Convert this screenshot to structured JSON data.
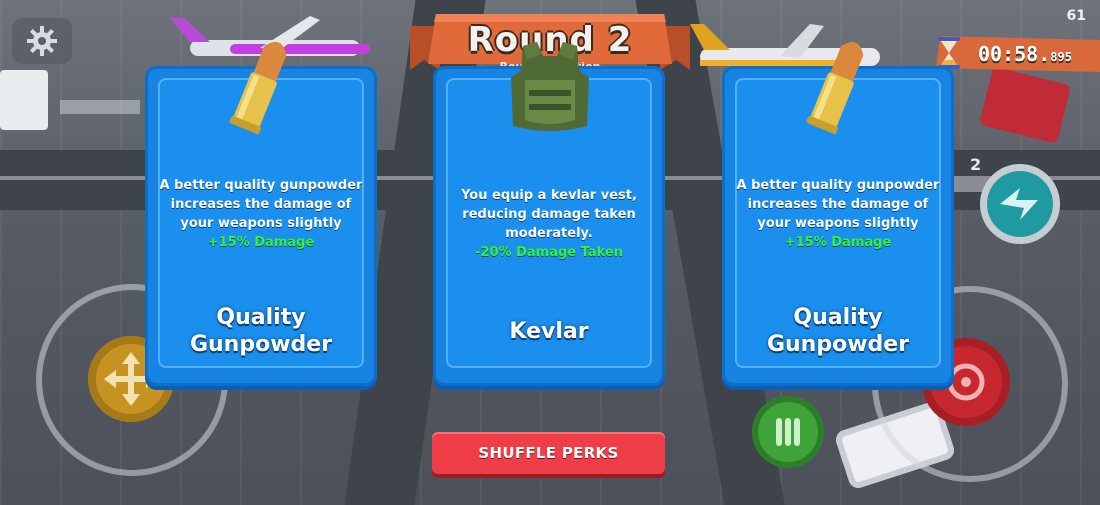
{
  "header": {
    "round_title": "Round 2",
    "round_subtitle": "Round Selection"
  },
  "timer": {
    "main": "00:58.",
    "ms": "895"
  },
  "fps_counter": "61",
  "side_badge": "2",
  "cards": [
    {
      "icon": "bullet-icon",
      "description": "A better quality gunpowder increases the damage of your weapons slightly",
      "bonus": "+15% Damage",
      "name_line1": "Quality",
      "name_line2": "Gunpowder"
    },
    {
      "icon": "kevlar-vest-icon",
      "description": "You equip a kevlar vest, reducing damage taken moderately.",
      "bonus": "-20% Damage Taken",
      "name_line1": "Kevlar",
      "name_line2": ""
    },
    {
      "icon": "bullet-icon",
      "description": "A better quality gunpowder increases the damage of your weapons slightly",
      "bonus": "+15% Damage",
      "name_line1": "Quality",
      "name_line2": "Gunpowder"
    }
  ],
  "shuffle_button": "SHUFFLE PERKS",
  "colors": {
    "card_blue": "#1784e3",
    "bonus_green": "#36f236",
    "shuffle_red": "#ef3e47",
    "banner_orange": "#e06a3a"
  }
}
